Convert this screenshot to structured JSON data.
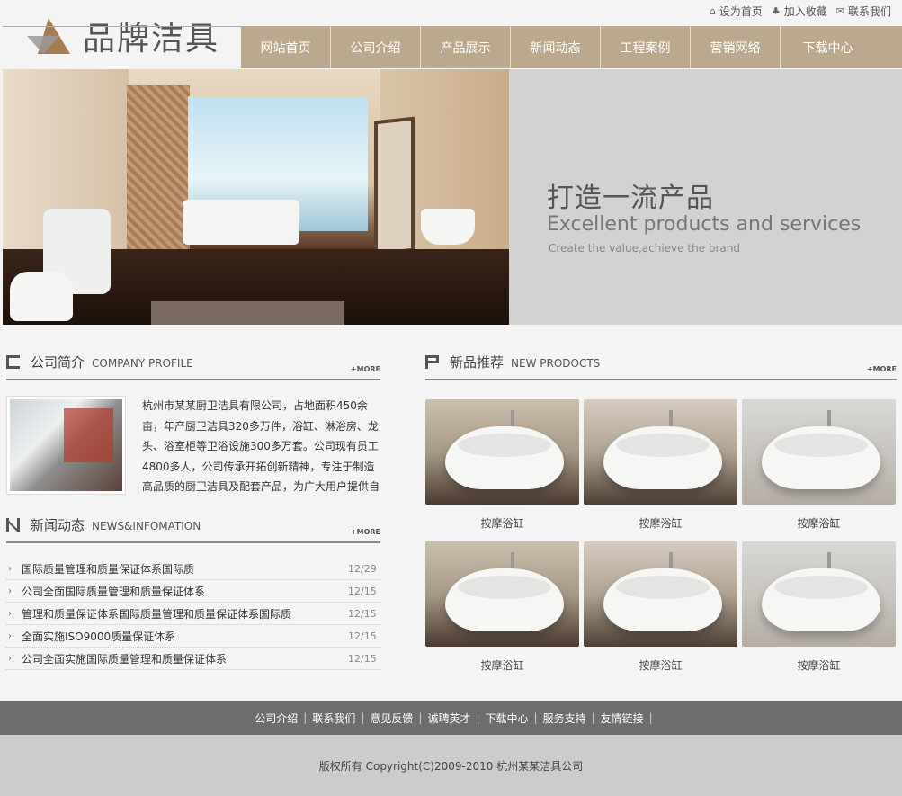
{
  "top_links": [
    {
      "icon": "home-icon",
      "label": "设为首页"
    },
    {
      "icon": "bookmark-icon",
      "label": "加入收藏"
    },
    {
      "icon": "mail-icon",
      "label": "联系我们"
    }
  ],
  "brand": {
    "name": "品牌洁具",
    "logo_colors": [
      "#a67c52",
      "#999999"
    ]
  },
  "nav": [
    "网站首页",
    "公司介绍",
    "产品展示",
    "新闻动态",
    "工程案例",
    "营销网络",
    "下载中心"
  ],
  "banner": {
    "title_cn": "打造一流产品",
    "title_en": "Excellent products and services",
    "subtitle": "Create the value,achieve the brand"
  },
  "profile": {
    "title_cn": "公司简介",
    "title_en": "COMPANY PROFILE",
    "more": "+MORE",
    "text": "杭州市某某厨卫洁具有限公司，占地面积450余亩，年产厨卫洁具320多万件，浴缸、淋浴房、龙头、浴室柜等卫浴设施300多万套。公司现有员工4800多人，公司传承开拓创新精神，专注于制造高品质的厨卫洁具及配套产品，为广大用户提供自"
  },
  "news": {
    "title_cn": "新闻动态",
    "title_en": "NEWS&INFOMATION",
    "more": "+MORE",
    "items": [
      {
        "title": "国际质量管理和质量保证体系国际质",
        "date": "12/29"
      },
      {
        "title": "公司全面国际质量管理和质量保证体系",
        "date": "12/15"
      },
      {
        "title": "管理和质量保证体系国际质量管理和质量保证体系国际质",
        "date": "12/15"
      },
      {
        "title": "全面实施ISO9000质量保证体系",
        "date": "12/15"
      },
      {
        "title": "公司全面实施国际质量管理和质量保证体系",
        "date": "12/15"
      }
    ]
  },
  "products": {
    "title_cn": "新品推荐",
    "title_en": "NEW PRODOCTS",
    "more": "+MORE",
    "items": [
      {
        "name": "按摩浴缸"
      },
      {
        "name": "按摩浴缸"
      },
      {
        "name": "按摩浴缸"
      },
      {
        "name": "按摩浴缸"
      },
      {
        "name": "按摩浴缸"
      },
      {
        "name": "按摩浴缸"
      }
    ]
  },
  "footer": {
    "links": [
      "公司介绍",
      "联系我们",
      "意见反馈",
      "诚聘英才",
      "下载中心",
      "服务支持",
      "友情链接"
    ],
    "copyright": "版权所有  Copyright(C)2009-2010 杭州某某洁具公司"
  },
  "colors": {
    "nav_bg": "#bba98f",
    "footer_nav_bg": "#6d6d6d",
    "copyright_bg": "#cccccc",
    "banner_bg": "#d2d2d2"
  }
}
